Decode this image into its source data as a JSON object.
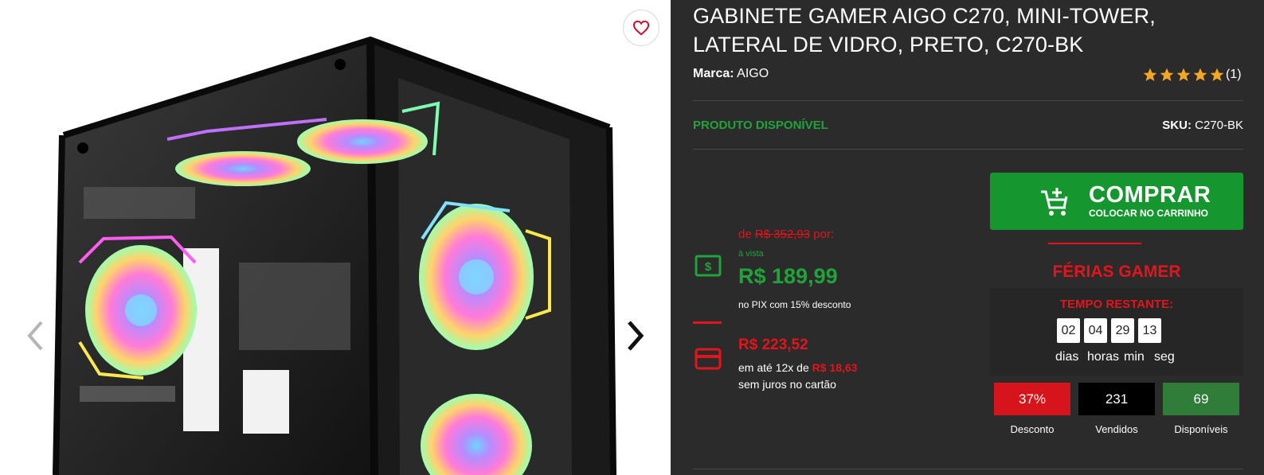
{
  "product": {
    "title": "GABINETE GAMER AIGO C270, MINI-TOWER, LATERAL DE VIDRO, PRETO, C270-BK",
    "brand_label": "Marca:",
    "brand": "AIGO",
    "rating_stars": 5,
    "rating_count": "(1)",
    "availability": "PRODUTO DISPONÍVEL",
    "sku_label": "SKU:",
    "sku": "C270-BK"
  },
  "prices": {
    "old_prefix": "de",
    "old_price": "R$ 352,93",
    "old_suffix": "por:",
    "cash_label": "à vista",
    "pix_price": "R$ 189,99",
    "pix_note": "no PIX com 15% desconto",
    "card_price": "R$ 223,52",
    "installments_prefix": "em até 12x de",
    "installment_value": "R$ 18,63",
    "installments_note": "sem juros no cartão"
  },
  "buy": {
    "label": "COMPRAR",
    "sublabel": "COLOCAR NO CARRINHO"
  },
  "promo": {
    "title": "FÉRIAS GAMER",
    "timer_title": "TEMPO RESTANTE:",
    "digits": [
      "02",
      "04",
      "29",
      "13"
    ],
    "units": [
      "dias",
      "horas",
      "min",
      "seg"
    ],
    "stats": [
      {
        "value": "37%",
        "label": "Desconto",
        "color": "#d7141b"
      },
      {
        "value": "231",
        "label": "Vendidos",
        "color": "#000000"
      },
      {
        "value": "69",
        "label": "Disponíveis",
        "color": "#2f7d38"
      }
    ]
  },
  "colors": {
    "panel_bg": "#2b2b2b",
    "green": "#1fa33a",
    "buy_green": "#15962f",
    "red": "#e3141b",
    "star": "#f5a623"
  },
  "icons": {
    "favorite": "heart-icon",
    "prev": "chevron-left-icon",
    "next": "chevron-right-icon",
    "pix": "money-icon",
    "card": "credit-card-icon",
    "cart": "cart-add-icon"
  }
}
